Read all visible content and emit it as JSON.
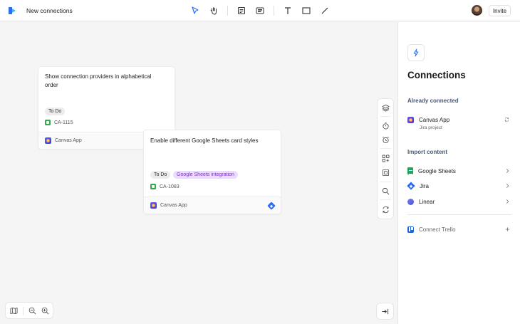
{
  "header": {
    "title": "New connections",
    "invite_label": "Invite"
  },
  "toolbar": {
    "tools": [
      "pointer",
      "hand",
      "sticky-note",
      "card",
      "text",
      "rectangle",
      "line"
    ]
  },
  "cards": [
    {
      "title": "Show connection providers in alphabetical order",
      "status": "To Do",
      "ticket": "CA-1115",
      "app": "Canvas App"
    },
    {
      "title": "Enable different Google Sheets card styles",
      "status": "To Do",
      "tag": "Google Sheets integration",
      "ticket": "CA-1083",
      "app": "Canvas App"
    }
  ],
  "panel": {
    "title": "Connections",
    "already_connected_label": "Already connected",
    "connected": {
      "name": "Canvas App",
      "sub": "Jira project"
    },
    "import_label": "Import content",
    "imports": [
      {
        "label": "Google Sheets",
        "icon": "google-sheets-icon"
      },
      {
        "label": "Jira",
        "icon": "jira-icon"
      },
      {
        "label": "Linear",
        "icon": "linear-icon"
      }
    ],
    "connect_trello": "Connect Trello"
  },
  "colors": {
    "accent": "#2d6ef5",
    "tag_purple": "#7b34c9",
    "ticket_green": "#36a852"
  }
}
